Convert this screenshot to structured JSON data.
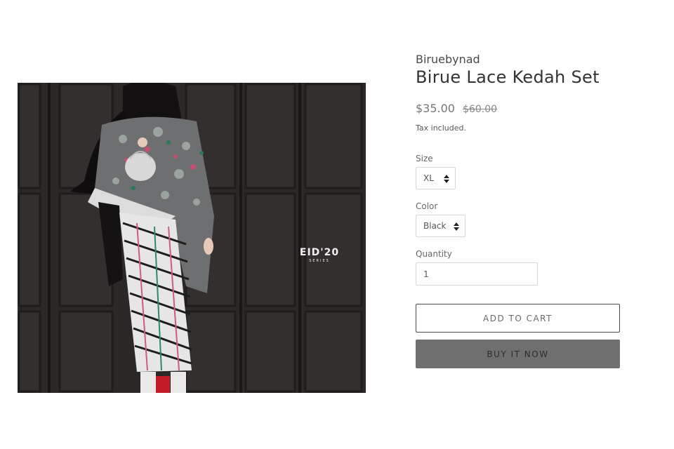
{
  "product": {
    "vendor": "Biruebynad",
    "title": "Birue Lace Kedah Set",
    "price": "$35.00",
    "compare_at_price": "$60.00",
    "tax_note": "Tax included.",
    "image": {
      "watermark_main": "EID'20",
      "watermark_sub": "SERIES"
    }
  },
  "options": {
    "size": {
      "label": "Size",
      "value": "XL"
    },
    "color": {
      "label": "Color",
      "value": "Black"
    },
    "quantity": {
      "label": "Quantity",
      "value": "1"
    }
  },
  "buttons": {
    "add_to_cart": "ADD TO CART",
    "buy_now": "BUY IT NOW"
  },
  "colors": {
    "photo_background": "#2b2827",
    "buy_button": "#6f6f6f"
  }
}
